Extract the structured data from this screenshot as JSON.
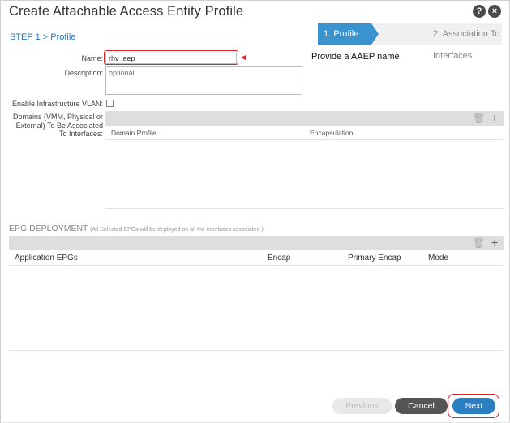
{
  "dialog": {
    "title": "Create Attachable Access Entity Profile",
    "help_icon": "?",
    "close_icon": "×"
  },
  "step_label": "STEP 1 > Profile",
  "wizard": {
    "steps": [
      {
        "label": "1. Profile",
        "active": true
      },
      {
        "label": "2. Association To Interfaces",
        "active": false
      }
    ]
  },
  "form": {
    "name_label": "Name:",
    "name_value": "rhv_aep",
    "description_label": "Description:",
    "description_placeholder": "optional",
    "infra_vlan_label": "Enable Infrastructure VLAN:",
    "domains_label_line1": "Domains (VMM, Physical or",
    "domains_label_line2": "External) To Be Associated",
    "domains_label_line3": "To Interfaces:"
  },
  "annotation": {
    "text": "Provide a AAEP name",
    "color": "#e0202a"
  },
  "domains_table": {
    "columns": [
      "Domain Profile",
      "Encapsulation"
    ],
    "rows": []
  },
  "epg_deployment": {
    "title": "EPG DEPLOYMENT",
    "subtitle": "(All Selected EPGs will be deployed on all the interfaces associated.)",
    "columns": [
      "Application EPGs",
      "Encap",
      "Primary Encap",
      "Mode"
    ],
    "rows": []
  },
  "toolbar_icons": {
    "delete": "trash-icon",
    "add": "plus-icon"
  },
  "buttons": {
    "previous": "Previous",
    "cancel": "Cancel",
    "next": "Next"
  },
  "colors": {
    "accent": "#3a93cf",
    "primary_button": "#2b7ec1",
    "highlight": "#e0202a"
  }
}
